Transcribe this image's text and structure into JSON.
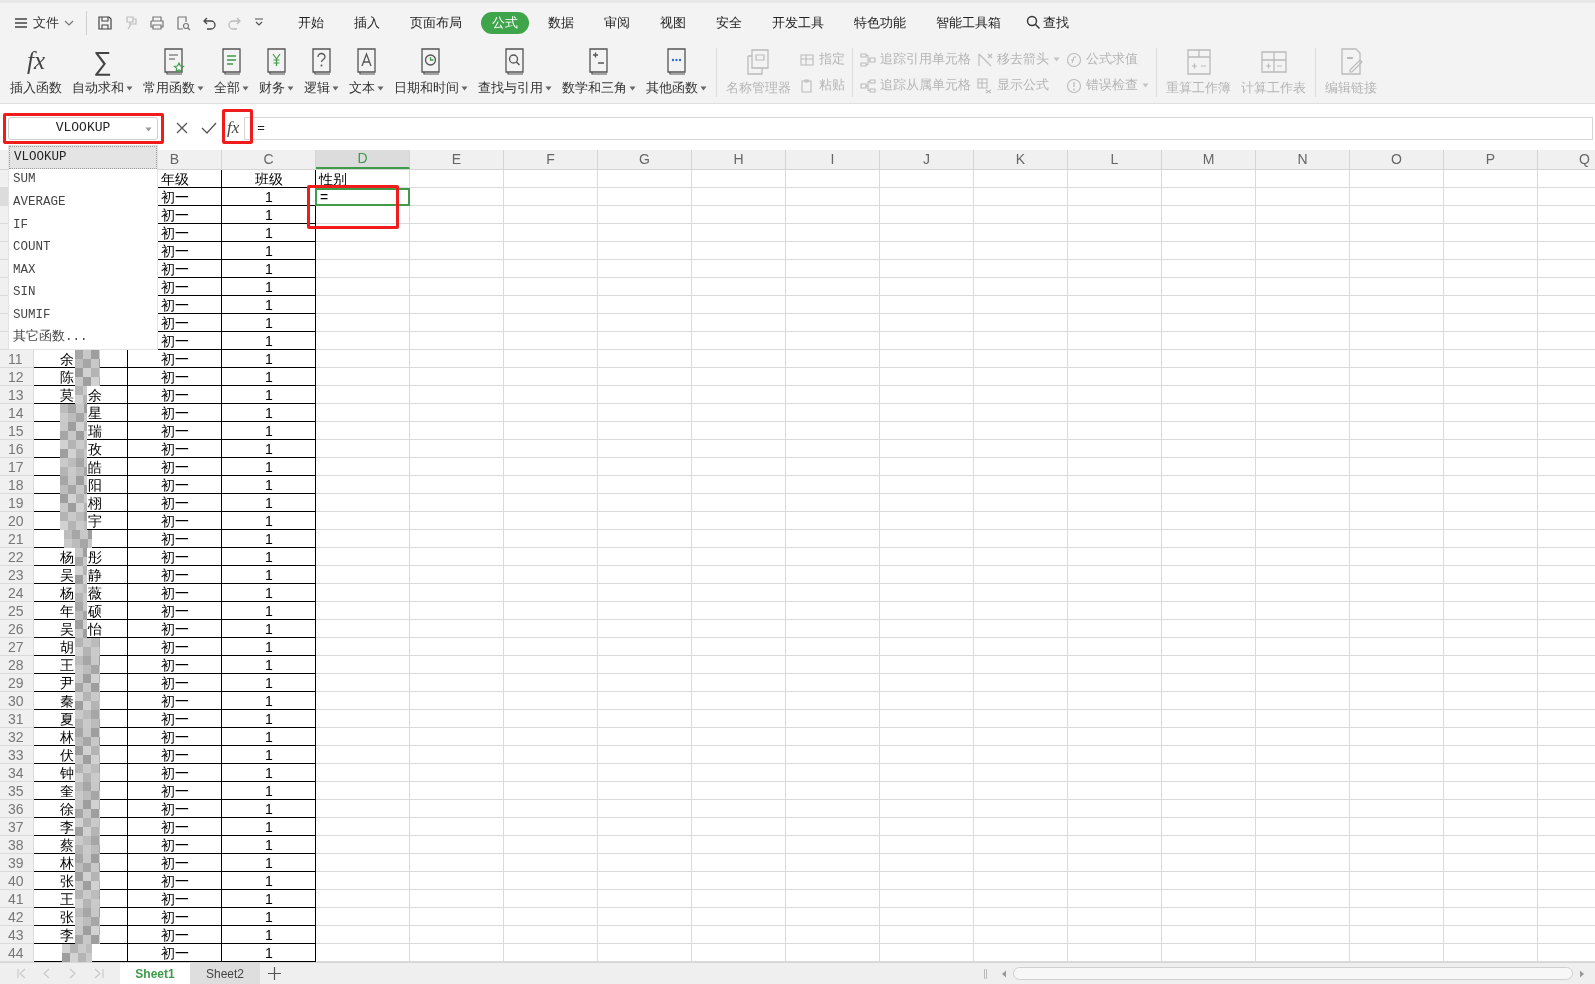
{
  "app_menu": {
    "label": "文件"
  },
  "tabs": [
    {
      "label": "开始",
      "selected": false
    },
    {
      "label": "插入",
      "selected": false
    },
    {
      "label": "页面布局",
      "selected": false
    },
    {
      "label": "公式",
      "selected": true
    },
    {
      "label": "数据",
      "selected": false
    },
    {
      "label": "审阅",
      "selected": false
    },
    {
      "label": "视图",
      "selected": false
    },
    {
      "label": "安全",
      "selected": false
    },
    {
      "label": "开发工具",
      "selected": false
    },
    {
      "label": "特色功能",
      "selected": false
    },
    {
      "label": "智能工具箱",
      "selected": false
    }
  ],
  "search": {
    "label": "查找"
  },
  "ribbon_groups": [
    {
      "items": [
        {
          "kind": "large",
          "label": "插入函数",
          "glyph": "fx",
          "dropdown": false,
          "disabled": false
        },
        {
          "kind": "large",
          "label": "自动求和",
          "glyph": "∑",
          "dropdown": true,
          "disabled": false
        },
        {
          "kind": "large",
          "label": "常用函数",
          "dropdown": true,
          "disabled": false
        },
        {
          "kind": "large",
          "label": "全部",
          "dropdown": true,
          "disabled": false
        },
        {
          "kind": "large",
          "label": "财务",
          "dropdown": true,
          "disabled": false
        },
        {
          "kind": "large",
          "label": "逻辑",
          "dropdown": true,
          "disabled": false
        },
        {
          "kind": "large",
          "label": "文本",
          "dropdown": true,
          "disabled": false
        },
        {
          "kind": "large",
          "label": "日期和时间",
          "dropdown": true,
          "disabled": false
        },
        {
          "kind": "large",
          "label": "查找与引用",
          "dropdown": true,
          "disabled": false
        },
        {
          "kind": "large",
          "label": "数学和三角",
          "dropdown": true,
          "disabled": false
        },
        {
          "kind": "large",
          "label": "其他函数",
          "dropdown": true,
          "disabled": false
        }
      ]
    },
    {
      "items": [
        {
          "kind": "large",
          "label": "名称管理器",
          "dropdown": false,
          "disabled": true
        },
        {
          "kind": "stack",
          "items": [
            {
              "label": "指定",
              "dropdown": false,
              "disabled": true
            },
            {
              "label": "粘贴",
              "dropdown": false,
              "disabled": true
            }
          ]
        }
      ]
    },
    {
      "items": [
        {
          "kind": "stack",
          "items": [
            {
              "label": "追踪引用单元格",
              "dropdown": false,
              "disabled": true
            },
            {
              "label": "追踪从属单元格",
              "dropdown": false,
              "disabled": true
            }
          ]
        },
        {
          "kind": "stack",
          "items": [
            {
              "label": "移去箭头",
              "dropdown": true,
              "disabled": true
            },
            {
              "label": "显示公式",
              "dropdown": false,
              "disabled": true
            }
          ]
        },
        {
          "kind": "stack",
          "items": [
            {
              "label": "公式求值",
              "dropdown": false,
              "disabled": true
            },
            {
              "label": "错误检查",
              "dropdown": true,
              "disabled": true
            }
          ]
        }
      ]
    },
    {
      "items": [
        {
          "kind": "large",
          "label": "重算工作簿",
          "dropdown": false,
          "disabled": true
        },
        {
          "kind": "large",
          "label": "计算工作表",
          "dropdown": false,
          "disabled": true
        }
      ]
    },
    {
      "items": [
        {
          "kind": "large",
          "label": "编辑链接",
          "dropdown": false,
          "disabled": true
        }
      ]
    }
  ],
  "formula_bar": {
    "name_box": "VLOOKUP",
    "insert_glyph": "fx",
    "formula": "="
  },
  "function_list": [
    {
      "label": "VLOOKUP",
      "selected": true
    },
    {
      "label": "SUM",
      "selected": false
    },
    {
      "label": "AVERAGE",
      "selected": false
    },
    {
      "label": "IF",
      "selected": false
    },
    {
      "label": "COUNT",
      "selected": false
    },
    {
      "label": "MAX",
      "selected": false
    },
    {
      "label": "SIN",
      "selected": false
    },
    {
      "label": "SUMIF",
      "selected": false
    },
    {
      "label": "其它函数...",
      "selected": false
    }
  ],
  "columns": [
    {
      "label": "B",
      "selected": false
    },
    {
      "label": "C",
      "selected": false
    },
    {
      "label": "D",
      "selected": true
    },
    {
      "label": "E",
      "selected": false
    },
    {
      "label": "F",
      "selected": false
    },
    {
      "label": "G",
      "selected": false
    },
    {
      "label": "H",
      "selected": false
    },
    {
      "label": "I",
      "selected": false
    },
    {
      "label": "J",
      "selected": false
    },
    {
      "label": "K",
      "selected": false
    },
    {
      "label": "L",
      "selected": false
    },
    {
      "label": "M",
      "selected": false
    },
    {
      "label": "N",
      "selected": false
    },
    {
      "label": "O",
      "selected": false
    },
    {
      "label": "P",
      "selected": false
    },
    {
      "label": "Q",
      "selected": false
    }
  ],
  "rows": [
    {
      "b": "年级",
      "c": "班级",
      "d": "性别",
      "selected": false
    },
    {
      "b": "初一",
      "c": "1",
      "d": "=",
      "selected": true
    },
    {
      "b": "初一",
      "c": "1",
      "selected": false
    },
    {
      "b": "初一",
      "c": "1",
      "selected": false
    },
    {
      "b": "初一",
      "c": "1",
      "selected": false
    },
    {
      "b": "初一",
      "c": "1",
      "selected": false
    },
    {
      "b": "初一",
      "c": "1",
      "selected": false
    },
    {
      "b": "初一",
      "c": "1",
      "selected": false
    },
    {
      "b": "初一",
      "c": "1",
      "selected": false
    },
    {
      "b": "初一",
      "c": "1",
      "selected": false
    },
    {
      "number": "11",
      "name_start": "余",
      "b": "初一",
      "c": "1",
      "selected": false
    },
    {
      "number": "12",
      "name_start": "陈",
      "b": "初一",
      "c": "1",
      "selected": false
    },
    {
      "number": "13",
      "name_start": "莫",
      "name_end": "余",
      "b": "初一",
      "c": "1",
      "selected": false
    },
    {
      "number": "14",
      "name_end": "星",
      "b": "初一",
      "c": "1",
      "selected": false
    },
    {
      "number": "15",
      "name_end": "瑞",
      "b": "初一",
      "c": "1",
      "selected": false
    },
    {
      "number": "16",
      "name_end": "孜",
      "b": "初一",
      "c": "1",
      "selected": false
    },
    {
      "number": "17",
      "name_end": "皓",
      "b": "初一",
      "c": "1",
      "selected": false
    },
    {
      "number": "18",
      "name_end": "阳",
      "b": "初一",
      "c": "1",
      "selected": false
    },
    {
      "number": "19",
      "name_end": "栩",
      "b": "初一",
      "c": "1",
      "selected": false
    },
    {
      "number": "20",
      "name_end": "宇",
      "b": "初一",
      "c": "1",
      "selected": false
    },
    {
      "number": "21",
      "b": "初一",
      "c": "1",
      "selected": false
    },
    {
      "number": "22",
      "name_start": "杨",
      "name_end": "彤",
      "b": "初一",
      "c": "1",
      "selected": false
    },
    {
      "number": "23",
      "name_start": "吴",
      "name_end": "静",
      "b": "初一",
      "c": "1",
      "selected": false
    },
    {
      "number": "24",
      "name_start": "杨",
      "name_end": "薇",
      "b": "初一",
      "c": "1",
      "selected": false
    },
    {
      "number": "25",
      "name_start": "年",
      "name_end": "硕",
      "b": "初一",
      "c": "1",
      "selected": false
    },
    {
      "number": "26",
      "name_start": "吴",
      "name_end": "怡",
      "b": "初一",
      "c": "1",
      "selected": false
    },
    {
      "number": "27",
      "name_start": "胡",
      "b": "初一",
      "c": "1",
      "selected": false
    },
    {
      "number": "28",
      "name_start": "王",
      "b": "初一",
      "c": "1",
      "selected": false
    },
    {
      "number": "29",
      "name_start": "尹",
      "b": "初一",
      "c": "1",
      "selected": false
    },
    {
      "number": "30",
      "name_start": "秦",
      "b": "初一",
      "c": "1",
      "selected": false
    },
    {
      "number": "31",
      "name_start": "夏",
      "b": "初一",
      "c": "1",
      "selected": false
    },
    {
      "number": "32",
      "name_start": "林",
      "b": "初一",
      "c": "1",
      "selected": false
    },
    {
      "number": "33",
      "name_start": "伏",
      "b": "初一",
      "c": "1",
      "selected": false
    },
    {
      "number": "34",
      "name_start": "钟",
      "b": "初一",
      "c": "1",
      "selected": false
    },
    {
      "number": "35",
      "name_start": "奎",
      "b": "初一",
      "c": "1",
      "selected": false
    },
    {
      "number": "36",
      "name_start": "徐",
      "b": "初一",
      "c": "1",
      "selected": false
    },
    {
      "number": "37",
      "name_start": "李",
      "b": "初一",
      "c": "1",
      "selected": false
    },
    {
      "number": "38",
      "name_start": "蔡",
      "b": "初一",
      "c": "1",
      "selected": false
    },
    {
      "number": "39",
      "name_start": "林",
      "b": "初一",
      "c": "1",
      "selected": false
    },
    {
      "number": "40",
      "name_start": "张",
      "b": "初一",
      "c": "1",
      "selected": false
    },
    {
      "number": "41",
      "name_start": "王",
      "b": "初一",
      "c": "1",
      "selected": false
    },
    {
      "number": "42",
      "name_start": "张",
      "b": "初一",
      "c": "1",
      "selected": false
    },
    {
      "number": "43",
      "name_start": "李",
      "b": "初一",
      "c": "1",
      "selected": false
    },
    {
      "number": "44",
      "b": "初一",
      "c": "1",
      "selected": false
    }
  ],
  "sheets": [
    {
      "label": "Sheet1",
      "selected": true
    },
    {
      "label": "Sheet2",
      "selected": false
    }
  ]
}
